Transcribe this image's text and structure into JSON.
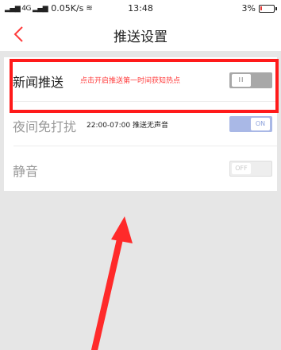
{
  "status_bar": {
    "network": "4G",
    "speed": "0.05K/s",
    "time": "13:48",
    "battery": "3%"
  },
  "navbar": {
    "back_icon": "chevron-left-icon",
    "title": "推送设置"
  },
  "settings": [
    {
      "label": "新闻推送",
      "desc": "点击开启推送第一时间获知热点",
      "toggle_text": "II",
      "state": "off"
    },
    {
      "label": "夜间免打扰",
      "desc": "22:00-07:00 推送无声音",
      "toggle_text": "ON",
      "state": "on"
    },
    {
      "label": "静音",
      "desc": "",
      "toggle_text": "OFF",
      "state": "off"
    }
  ],
  "colors": {
    "accent": "#ff3b3b",
    "annotation": "#ff1a1a",
    "toggle_on": "#a9b8e6"
  }
}
